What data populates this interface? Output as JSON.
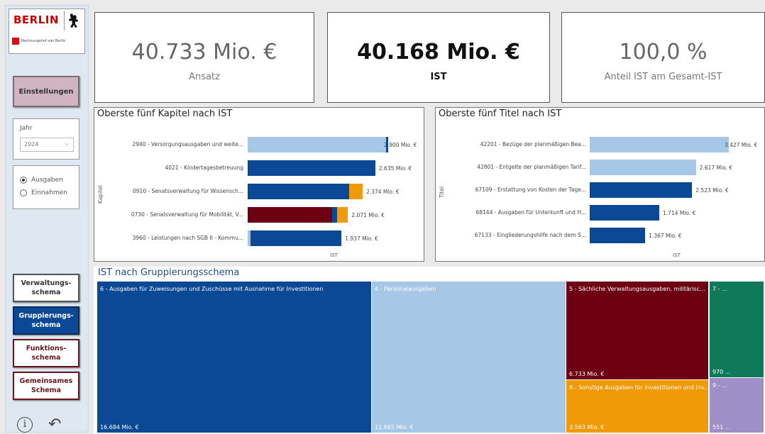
{
  "sidebar": {
    "logo_text": "BERLIN",
    "logo_subtext": "Rechnungshof von Berlin",
    "settings_label": "Einstellungen",
    "jahr_label": "Jahr",
    "jahr_value": "2024",
    "radio": [
      {
        "label": "Ausgaben",
        "selected": true
      },
      {
        "label": "Einnahmen",
        "selected": false
      }
    ],
    "nav": [
      {
        "label": "Verwaltungs-\nschema",
        "active": false
      },
      {
        "label": "Gruppierungs-\nschema",
        "active": true
      },
      {
        "label": "Funktions-\nschema",
        "active": false
      },
      {
        "label": "Gemeinsames\nSchema",
        "active": false
      }
    ],
    "info_icon": "info-icon",
    "back_icon": "undo-icon"
  },
  "kpis": [
    {
      "value": "40.733 Mio. €",
      "label": "Ansatz"
    },
    {
      "value": "40.168 Mio. €",
      "label": "IST"
    },
    {
      "value": "100,0 %",
      "label": "Anteil IST am Gesamt-IST"
    }
  ],
  "chart_data": [
    {
      "type": "bar",
      "title": "Oberste fünf Kapitel nach IST",
      "ylabel": "Kapitel",
      "xlabel": "IST",
      "categories": [
        "2940 - Versorgungsausgaben und weite...",
        "4021 - Kindertagesbetreuung",
        "0910 - Senatsverwaltung für Wissensch...",
        "0730 - Senatsverwaltung für Mobilität, V...",
        "3960 - Leistungen nach SGB II - Kommu..."
      ],
      "values": [
        2900,
        2635,
        2374,
        2071,
        1937
      ],
      "value_labels": [
        "2.900 Mio. €",
        "2.635 Mio. €",
        "2.374 Mio. €",
        "2.071 Mio. €",
        "1.937 Mio. €"
      ],
      "segments": [
        [
          {
            "color": "#a7c7e7",
            "value": 2850
          },
          {
            "color": "#0b4996",
            "value": 50
          }
        ],
        [
          {
            "color": "#0b4996",
            "value": 2635
          }
        ],
        [
          {
            "color": "#0b4996",
            "value": 2100
          },
          {
            "color": "#f09a0a",
            "value": 274
          }
        ],
        [
          {
            "color": "#6e0014",
            "value": 1750
          },
          {
            "color": "#0b4996",
            "value": 100
          },
          {
            "color": "#f09a0a",
            "value": 221
          }
        ],
        [
          {
            "color": "#a7c7e7",
            "value": 60
          },
          {
            "color": "#0b4996",
            "value": 1877
          }
        ]
      ]
    },
    {
      "type": "bar",
      "title": "Oberste fünf Titel nach IST",
      "ylabel": "Titel",
      "xlabel": "IST",
      "categories": [
        "42201 - Bezüge der planmäßigen Bea...",
        "42801 - Entgelte der planmäßigen Tarif...",
        "67109 - Erstattung von Kosten der Tage...",
        "68144 - Ausgaben für Unterkunft und H...",
        "67133 - Eingliederungshilfe nach dem S..."
      ],
      "values": [
        3427,
        2617,
        2523,
        1714,
        1367
      ],
      "value_labels": [
        "3.427 Mio. €",
        "2.617 Mio. €",
        "2.523 Mio. €",
        "1.714 Mio. €",
        "1.367 Mio. €"
      ],
      "colors": [
        "#a7c7e7",
        "#a7c7e7",
        "#0b4996",
        "#0b4996",
        "#0b4996"
      ]
    },
    {
      "type": "heatmap",
      "title": "IST nach Gruppierungsschema",
      "tiles": [
        {
          "label": "6 - Ausgaben für Zuweisungen und Zuschüsse mit Ausnahme für Investitionen",
          "value_label": "16.684 Mio. €",
          "value": 16684,
          "color": "#0b4996"
        },
        {
          "label": "4 - Personalausgaben",
          "value_label": "11.665 Mio. €",
          "value": 11665,
          "color": "#a7c7e7"
        },
        {
          "label": "5 - Sächliche Verwaltungsausgaben, militärisc...",
          "value_label": "6.733 Mio. €",
          "value": 6733,
          "color": "#6e0014"
        },
        {
          "label": "8 - Sonstige Ausgaben für Investitionen und Inv...",
          "value_label": "3.563 Mio. €",
          "value": 3563,
          "color": "#f09a0a"
        },
        {
          "label": "7 - ...",
          "value_label": "970 ...",
          "value": 970,
          "color": "#0f7a5a"
        },
        {
          "label": "9 - ...",
          "value_label": "551 ...",
          "value": 551,
          "color": "#9e8fc9"
        }
      ]
    }
  ]
}
